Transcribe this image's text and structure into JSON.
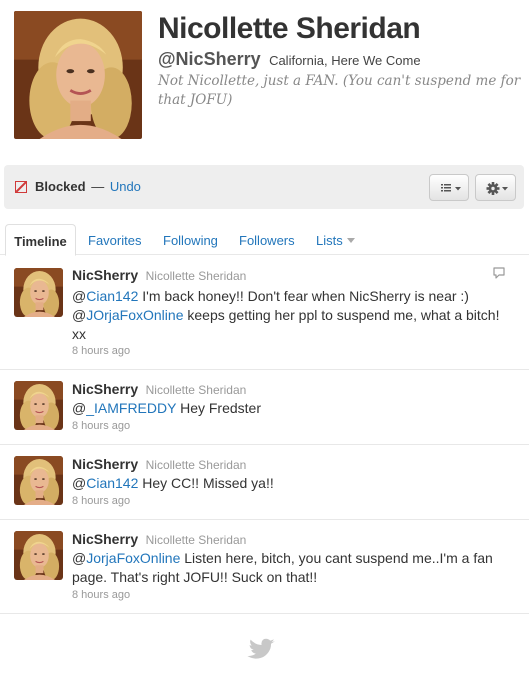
{
  "profile": {
    "name": "Nicollette Sheridan",
    "handle": "@NicSherry",
    "location": "California, Here We Come",
    "bio": "Not Nicollette, just a FAN. (You can't suspend me for that JOFU)"
  },
  "block_bar": {
    "status": "Blocked",
    "separator": "—",
    "undo": "Undo",
    "list_icon": "list-icon",
    "gear_icon": "gear-icon"
  },
  "tabs": [
    "Timeline",
    "Favorites",
    "Following",
    "Followers",
    "Lists"
  ],
  "tweets": [
    {
      "user": "NicSherry",
      "full_name": "Nicollette Sheridan",
      "parts": [
        {
          "t": "@",
          "m": false
        },
        {
          "t": "Cian142",
          "m": true
        },
        {
          "t": " I'm back honey!! Don't fear when NicSherry is near :) @",
          "m": false
        },
        {
          "t": "JOrjaFoxOnline",
          "m": true
        },
        {
          "t": " keeps getting her ppl to suspend me, what a bitch! xx",
          "m": false
        }
      ],
      "time": "8 hours ago"
    },
    {
      "user": "NicSherry",
      "full_name": "Nicollette Sheridan",
      "parts": [
        {
          "t": "@",
          "m": false
        },
        {
          "t": "_IAMFREDDY",
          "m": true
        },
        {
          "t": " Hey Fredster",
          "m": false
        }
      ],
      "time": "8 hours ago"
    },
    {
      "user": "NicSherry",
      "full_name": "Nicollette Sheridan",
      "parts": [
        {
          "t": "@",
          "m": false
        },
        {
          "t": "Cian142",
          "m": true
        },
        {
          "t": " Hey CC!! Missed ya!!",
          "m": false
        }
      ],
      "time": "8 hours ago"
    },
    {
      "user": "NicSherry",
      "full_name": "Nicollette Sheridan",
      "parts": [
        {
          "t": "@",
          "m": false
        },
        {
          "t": "JorjaFoxOnline",
          "m": true
        },
        {
          "t": " Listen here, bitch, you cant suspend me..I'm a fan page. That's right JOFU!! Suck on that!!",
          "m": false
        }
      ],
      "time": "8 hours ago"
    }
  ],
  "icons": {
    "reply": "reply-icon",
    "bird": "twitter-bird-icon",
    "blocked": "blocked-icon"
  },
  "colors": {
    "link": "#2276bb",
    "blocked": "#d03a3a",
    "muted": "#999999"
  }
}
